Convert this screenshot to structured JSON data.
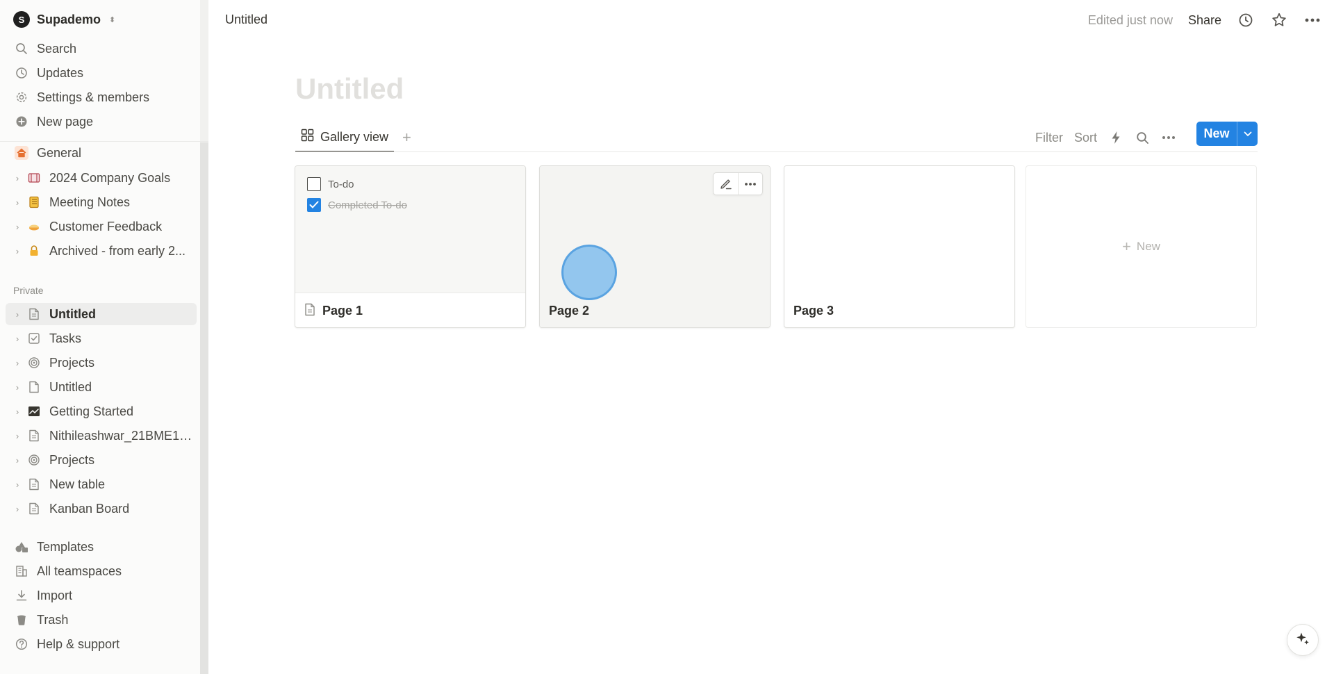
{
  "workspace": {
    "name": "Supademo",
    "logo_letter": "S"
  },
  "sidebar": {
    "top_items": [
      {
        "label": "Search",
        "icon": "search-icon"
      },
      {
        "label": "Updates",
        "icon": "clock-icon"
      },
      {
        "label": "Settings & members",
        "icon": "gear-icon"
      },
      {
        "label": "New page",
        "icon": "plus-circle-icon"
      }
    ],
    "teamspace_items": [
      {
        "label": "General",
        "icon": "home-icon"
      },
      {
        "label": "2024 Company Goals",
        "icon": "goal-icon"
      },
      {
        "label": "Meeting Notes",
        "icon": "notebook-icon"
      },
      {
        "label": "Customer Feedback",
        "icon": "pie-icon"
      },
      {
        "label": "Archived - from early 2...",
        "icon": "lock-icon"
      }
    ],
    "private_label": "Private",
    "private_items": [
      {
        "label": "Untitled",
        "icon": "page-icon"
      },
      {
        "label": "Tasks",
        "icon": "checkbox-icon"
      },
      {
        "label": "Projects",
        "icon": "target-icon"
      },
      {
        "label": "Untitled",
        "icon": "page-icon"
      },
      {
        "label": "Getting Started",
        "icon": "chart-icon"
      },
      {
        "label": "Nithileashwar_21BME10...",
        "icon": "page-icon"
      },
      {
        "label": "Projects",
        "icon": "target-icon"
      },
      {
        "label": "New table",
        "icon": "page-icon"
      },
      {
        "label": "Kanban Board",
        "icon": "page-icon"
      }
    ],
    "bottom_items": [
      {
        "label": "Templates",
        "icon": "templates-icon"
      },
      {
        "label": "All teamspaces",
        "icon": "building-icon"
      },
      {
        "label": "Import",
        "icon": "download-icon"
      },
      {
        "label": "Trash",
        "icon": "trash-icon"
      },
      {
        "label": "Help & support",
        "icon": "help-icon"
      }
    ]
  },
  "topbar": {
    "title": "Untitled",
    "edited": "Edited just now",
    "share": "Share"
  },
  "page": {
    "title": "Untitled"
  },
  "database": {
    "view_tab": "Gallery view",
    "actions": {
      "filter": "Filter",
      "sort": "Sort"
    },
    "new_button": "New",
    "cards": [
      {
        "title": "Page 1",
        "todos": [
          {
            "text": "To-do",
            "done": false
          },
          {
            "text": "Completed To-do",
            "done": true
          }
        ]
      },
      {
        "title": "Page 2"
      },
      {
        "title": "Page 3"
      }
    ],
    "new_card": "New"
  },
  "colors": {
    "accent": "#2383e2",
    "sidebar_bg": "#fbfbfa",
    "click_marker": "#6eb4eb"
  }
}
